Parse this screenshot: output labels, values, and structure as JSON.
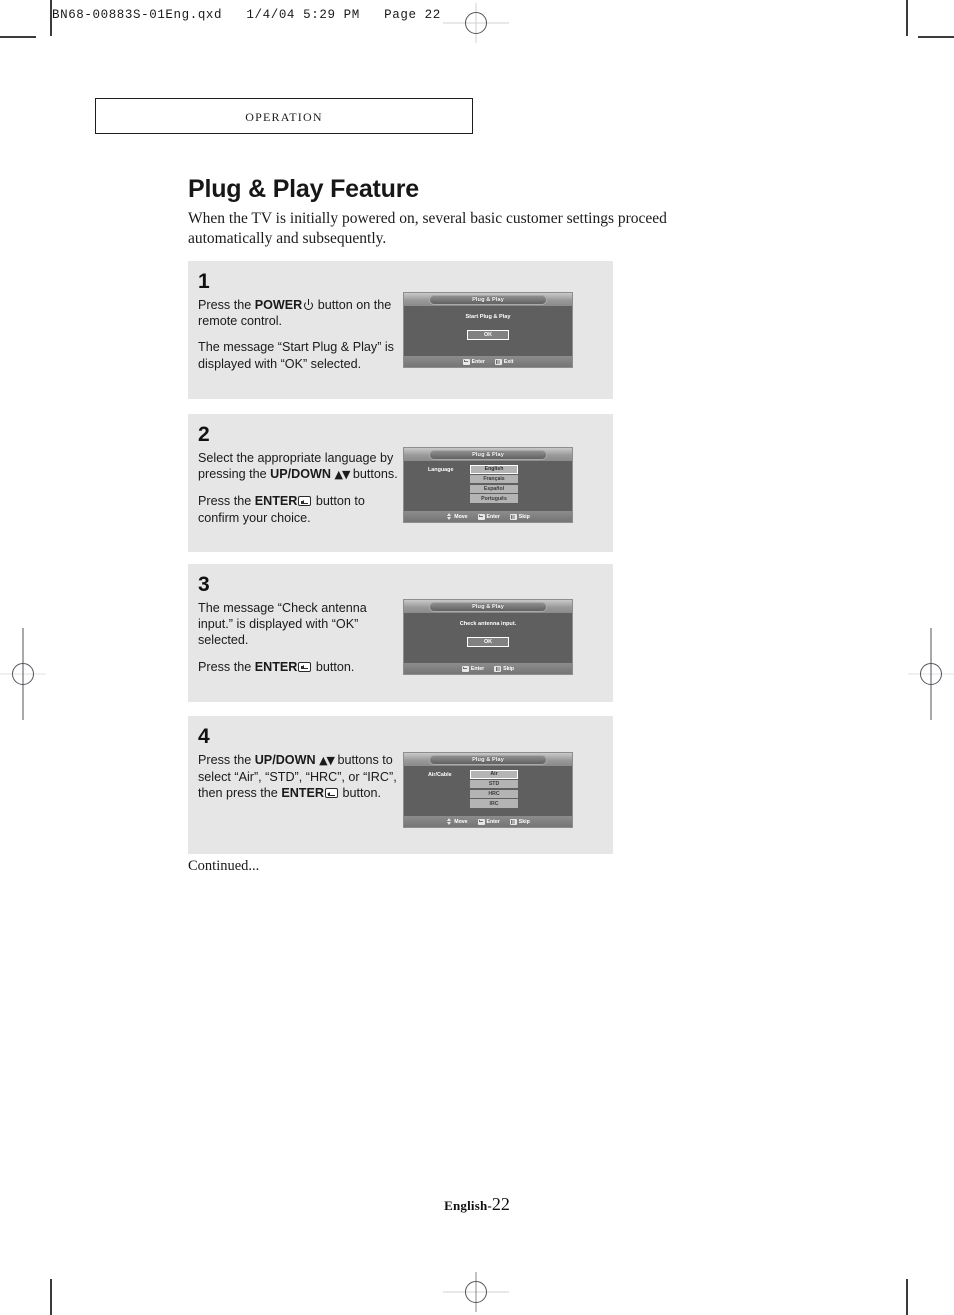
{
  "file_header": "BN68-00883S-01Eng.qxd   1/4/04 5:29 PM   Page 22",
  "running_head": "Operation",
  "title": "Plug & Play Feature",
  "intro": "When the TV is initially powered on, several basic customer settings proceed automatically and subsequently.",
  "steps": [
    {
      "number": "1",
      "paragraphs": [
        {
          "pre": "Press the ",
          "bold": "POWER",
          "icon": "power-icon",
          "post": " button on the remote control."
        },
        {
          "pre": "The message “Start Plug & Play” is displayed with “OK” selected.",
          "bold": "",
          "post": ""
        }
      ],
      "osd": {
        "type": "message",
        "title": "Plug & Play",
        "message": "Start Plug & Play",
        "button": "OK",
        "footer": [
          {
            "icon": "enter-key-icon",
            "label": "Enter"
          },
          {
            "icon": "menu-bars-icon",
            "label": "Exit"
          }
        ]
      }
    },
    {
      "number": "2",
      "paragraphs": [
        {
          "pre": "Select the appropriate language by pressing the ",
          "bold": "UP/DOWN",
          "arrows": "▲▼",
          "post": " buttons."
        },
        {
          "pre": "Press the ",
          "bold": "ENTER",
          "icon": "enter-key-icon",
          "post": " button to confirm your choice."
        }
      ],
      "osd": {
        "type": "list",
        "title": "Plug & Play",
        "row_label": "Language",
        "options": [
          "English",
          "Français",
          "Español",
          "Português"
        ],
        "selected_index": 0,
        "footer": [
          {
            "icon": "updown-arrows-icon",
            "label": "Move"
          },
          {
            "icon": "enter-key-icon",
            "label": "Enter"
          },
          {
            "icon": "menu-bars-icon",
            "label": "Skip"
          }
        ]
      }
    },
    {
      "number": "3",
      "paragraphs": [
        {
          "pre": "The message “Check antenna input.” is displayed with “OK” selected.",
          "bold": "",
          "post": ""
        },
        {
          "pre": "Press the ",
          "bold": "ENTER",
          "icon": "enter-key-icon",
          "post": " button."
        }
      ],
      "osd": {
        "type": "message",
        "title": "Plug & Play",
        "message": "Check antenna input.",
        "button": "OK",
        "footer": [
          {
            "icon": "enter-key-icon",
            "label": "Enter"
          },
          {
            "icon": "menu-bars-icon",
            "label": "Skip"
          }
        ]
      }
    },
    {
      "number": "4",
      "paragraphs": [
        {
          "pre": "Press the ",
          "bold": "UP/DOWN",
          "arrows": "▲▼",
          "post": " buttons to select “Air”, “STD”, “HRC”, or “IRC”, then press the ",
          "bold2": "ENTER",
          "icon2": "enter-key-icon",
          "post2": " button."
        }
      ],
      "osd": {
        "type": "list",
        "title": "Plug & Play",
        "row_label": "Air/Cable",
        "options": [
          "Air",
          "STD",
          "HRC",
          "IRC"
        ],
        "selected_index": 0,
        "footer": [
          {
            "icon": "updown-arrows-icon",
            "label": "Move"
          },
          {
            "icon": "enter-key-icon",
            "label": "Enter"
          },
          {
            "icon": "menu-bars-icon",
            "label": "Skip"
          }
        ]
      }
    }
  ],
  "continued": "Continued...",
  "footer": {
    "language": "English-",
    "page_number": "22"
  },
  "colors": {
    "step_panel_bg": "#e6e6e6",
    "osd_body": "#5f5f5f",
    "osd_bar": "#9a9a9a",
    "osd_option": "#b4b4b4",
    "text": "#1a1a1a"
  }
}
